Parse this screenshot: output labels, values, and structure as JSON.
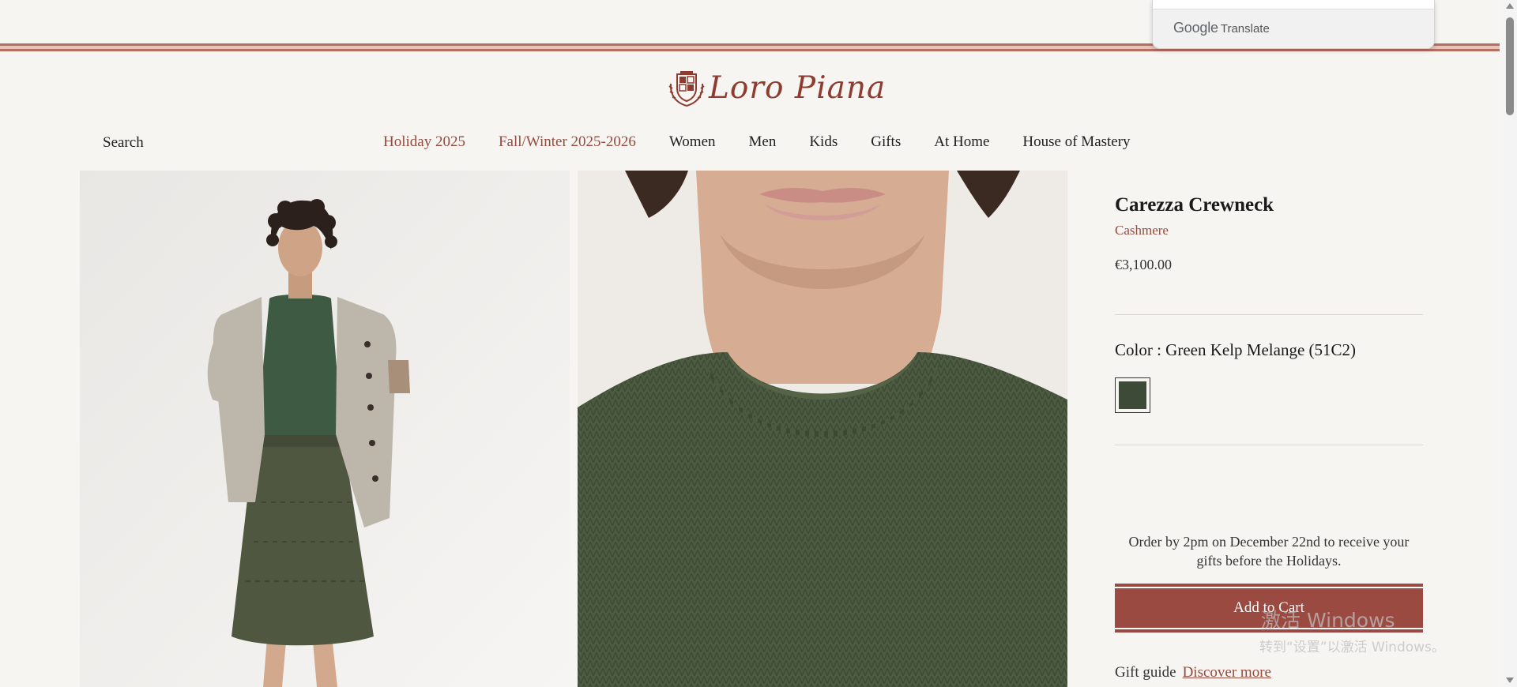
{
  "translate": {
    "brand_google": "Google",
    "brand_translate": "Translate"
  },
  "logo": {
    "text": "Loro Piana"
  },
  "header": {
    "search_label": "Search",
    "nav": [
      {
        "label": "Holiday 2025",
        "accent": true
      },
      {
        "label": "Fall/Winter 2025-2026",
        "accent": true
      },
      {
        "label": "Women",
        "accent": false
      },
      {
        "label": "Men",
        "accent": false
      },
      {
        "label": "Kids",
        "accent": false
      },
      {
        "label": "Gifts",
        "accent": false
      },
      {
        "label": "At Home",
        "accent": false
      },
      {
        "label": "House of Mastery",
        "accent": false
      }
    ]
  },
  "product": {
    "title": "Carezza Crewneck",
    "material": "Cashmere",
    "price": "€3,100.00",
    "color_label": "Color : Green Kelp Melange (51C2)",
    "swatch_color": "#3c4a37",
    "delivery_note": "Order by 2pm on December 22nd to receive your gifts before the Holidays.",
    "add_to_cart": "Add to Cart",
    "gift_guide_label": "Gift guide",
    "gift_guide_link": "Discover more"
  },
  "watermark": {
    "line1": "激活 Windows",
    "line2": "转到“设置”以激活 Windows。"
  },
  "colors": {
    "accent": "#944b3f",
    "button": "#9b4a41",
    "background": "#f6f5f2",
    "sweater_green": "#4a5a40"
  }
}
